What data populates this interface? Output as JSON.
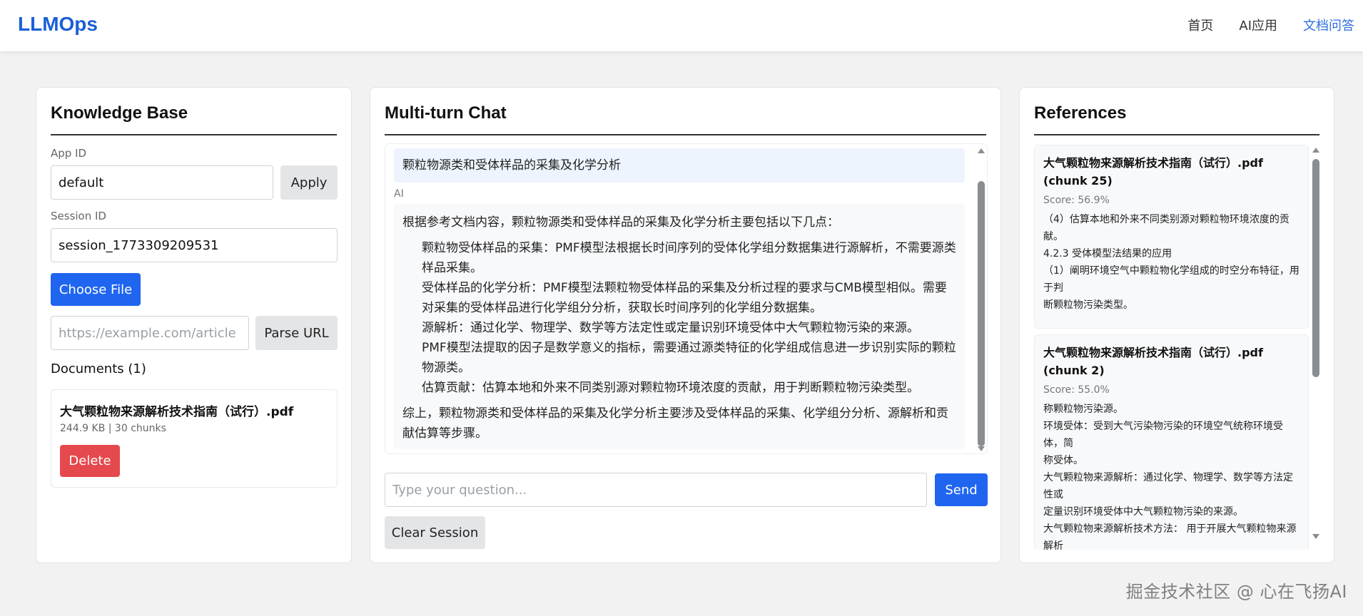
{
  "header": {
    "brand": "LLMOps",
    "nav": [
      {
        "label": "首页"
      },
      {
        "label": "AI应用"
      },
      {
        "label": "文档问答"
      }
    ]
  },
  "knowledge_base": {
    "title": "Knowledge Base",
    "app_id_label": "App ID",
    "app_id_value": "default",
    "apply_label": "Apply",
    "session_id_label": "Session ID",
    "session_id_value": "session_1773309209531",
    "choose_file_label": "Choose File",
    "url_placeholder": "https://example.com/article",
    "parse_url_label": "Parse URL",
    "documents_heading": "Documents (1)",
    "documents": [
      {
        "name": "大气颗粒物来源解析技术指南（试行）.pdf",
        "meta": "244.9 KB | 30 chunks",
        "delete_label": "Delete"
      }
    ]
  },
  "chat": {
    "title": "Multi-turn Chat",
    "user_message": "颗粒物源类和受体样品的采集及化学分析",
    "ai_label": "AI",
    "ai_intro": "根据参考文档内容，颗粒物源类和受体样品的采集及化学分析主要包括以下几点：",
    "ai_points": [
      "颗粒物受体样品的采集：PMF模型法根据长时间序列的受体化学组分数据集进行源解析，不需要源类样品采集。",
      "受体样品的化学分析：PMF模型法颗粒物受体样品的采集及分析过程的要求与CMB模型相似。需要对采集的受体样品进行化学组分分析，获取长时间序列的化学组分数据集。",
      "源解析：通过化学、物理学、数学等方法定性或定量识别环境受体中大气颗粒物污染的来源。",
      "PMF模型法提取的因子是数学意义的指标，需要通过源类特征的化学组成信息进一步识别实际的颗粒物源类。",
      "估算贡献：估算本地和外来不同类别源对颗粒物环境浓度的贡献，用于判断颗粒物污染类型。"
    ],
    "ai_summary": "综上，颗粒物源类和受体样品的采集及化学分析主要涉及受体样品的采集、化学组分分析、源解析和贡献估算等步骤。",
    "input_placeholder": "Type your question...",
    "send_label": "Send",
    "clear_label": "Clear Session"
  },
  "references": {
    "title": "References",
    "items": [
      {
        "title": "大气颗粒物来源解析技术指南（试行）.pdf (chunk 25)",
        "score": "Score: 56.9%",
        "text": "（4）估算本地和外来不同类别源对颗粒物环境浓度的贡献。\n4.2.3 受体模型法结果的应用\n（1）阐明环境空气中颗粒物化学组成的时空分布特征，用于判\n断颗粒物污染类型。"
      },
      {
        "title": "大气颗粒物来源解析技术指南（试行）.pdf (chunk 2)",
        "score": "Score: 55.0%",
        "text": "称颗粒物污染源。\n环境受体：受到大气污染物污染的环境空气统称环境受体，简\n称受体。\n大气颗粒物来源解析：通过化学、物理学、数学等方法定性或\n定量识别环境受体中大气颗粒物污染的来源。\n大气颗粒物来源解析技术方法： 用于开展大气颗粒物来源解析"
      }
    ]
  },
  "watermark": "掘金技术社区 @ 心在飞扬AI",
  "colors": {
    "brand": "#1a5fd6",
    "primary_button": "#1f65f0",
    "danger_button": "#e5484d",
    "active_nav": "#2f6fe0"
  }
}
